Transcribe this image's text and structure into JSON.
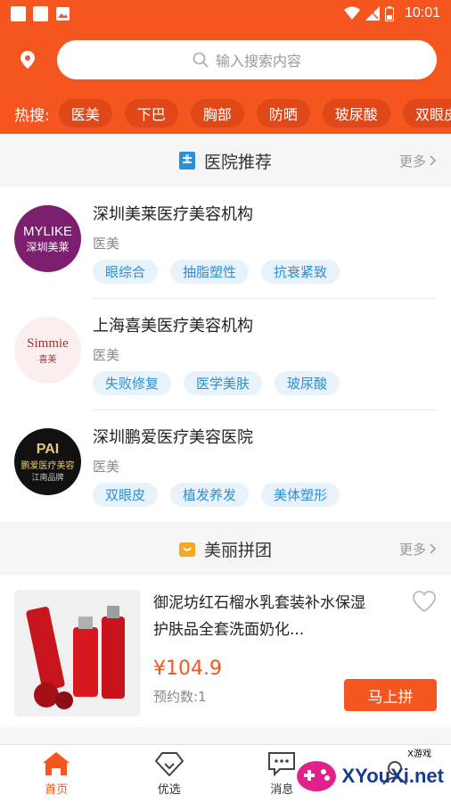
{
  "status_bar": {
    "time": "10:01"
  },
  "search": {
    "placeholder": "输入搜索内容"
  },
  "hot_search": {
    "label": "热搜:",
    "chips": [
      "医美",
      "下巴",
      "胸部",
      "防晒",
      "玻尿酸",
      "双眼皮"
    ]
  },
  "hospitals_section": {
    "title": "医院推荐",
    "more": "更多"
  },
  "hospitals": [
    {
      "name": "深圳美莱医疗美容机构",
      "type": "医美",
      "tags": [
        "眼综合",
        "抽脂塑性",
        "抗衰紧致"
      ],
      "logo_text": "MYLIKE",
      "logo_sub": "深圳美莱"
    },
    {
      "name": "上海喜美医疗美容机构",
      "type": "医美",
      "tags": [
        "失败修复",
        "医学美肤",
        "玻尿酸"
      ],
      "logo_text": "Simmie",
      "logo_sub": "喜美"
    },
    {
      "name": "深圳鹏爱医疗美容医院",
      "type": "医美",
      "tags": [
        "双眼皮",
        "植发养发",
        "美体塑形"
      ],
      "logo_text": "PAI",
      "logo_sub": "鹏爱医疗美容",
      "logo_sub2": "江南品牌"
    }
  ],
  "group_section": {
    "title": "美丽拼团",
    "more": "更多"
  },
  "group_product": {
    "title": "御泥坊红石榴水乳套装补水保湿护肤品全套洗面奶化...",
    "price": "¥104.9",
    "booked": "预约数:1",
    "button": "马上拼"
  },
  "tabs": [
    {
      "label": "首页",
      "icon": "home-icon"
    },
    {
      "label": "优选",
      "icon": "diamond-icon"
    },
    {
      "label": "消息",
      "icon": "message-icon"
    },
    {
      "label": "",
      "icon": "profile-icon"
    }
  ],
  "watermark": {
    "text": "XYouXi.net",
    "small": "X游戏"
  },
  "colors": {
    "accent": "#f5561f",
    "tag_text": "#2a8fd6",
    "tag_bg": "#e8f2fb"
  }
}
